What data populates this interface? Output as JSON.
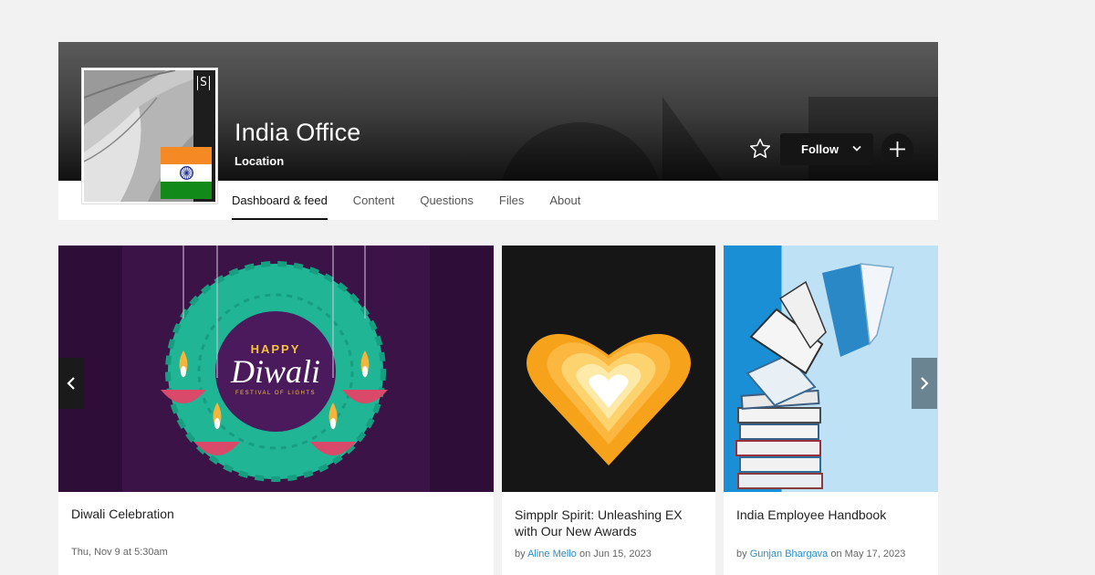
{
  "site": {
    "title": "India Office",
    "subtitle": "Location",
    "avatar_mark": "S",
    "follow_label": "Follow"
  },
  "tabs": [
    {
      "label": "Dashboard & feed",
      "active": true
    },
    {
      "label": "Content",
      "active": false
    },
    {
      "label": "Questions",
      "active": false
    },
    {
      "label": "Files",
      "active": false
    },
    {
      "label": "About",
      "active": false
    }
  ],
  "cards": [
    {
      "title": "Diwali Celebration",
      "image_text": {
        "happy": "HAPPY",
        "diwali": "Diwali",
        "festival": "FESTIVAL OF LIGHTS"
      },
      "date": "Thu, Nov 9 at 5:30am"
    },
    {
      "title_line1": "Simpplr Spirit: Unleashing EX",
      "title_line2": "with Our New Awards",
      "by": "by",
      "author": "Aline Mello",
      "on": "on Jun 15, 2023"
    },
    {
      "title": "India Employee Handbook",
      "by": "by",
      "author": "Gunjan Bhargava",
      "on": "on May 17, 2023"
    }
  ],
  "icons": {
    "star": "star-outline-icon",
    "chevron": "chevron-down-icon",
    "plus": "plus-icon",
    "prev": "chevron-left-icon",
    "next": "chevron-right-icon"
  },
  "colors": {
    "accent_link": "#2a8dc9",
    "banner_dark": "#111111",
    "diwali_purple": "#3b1347",
    "diwali_teal": "#1fb595",
    "flag_saffron": "#f58a24",
    "flag_green": "#128a1a"
  }
}
